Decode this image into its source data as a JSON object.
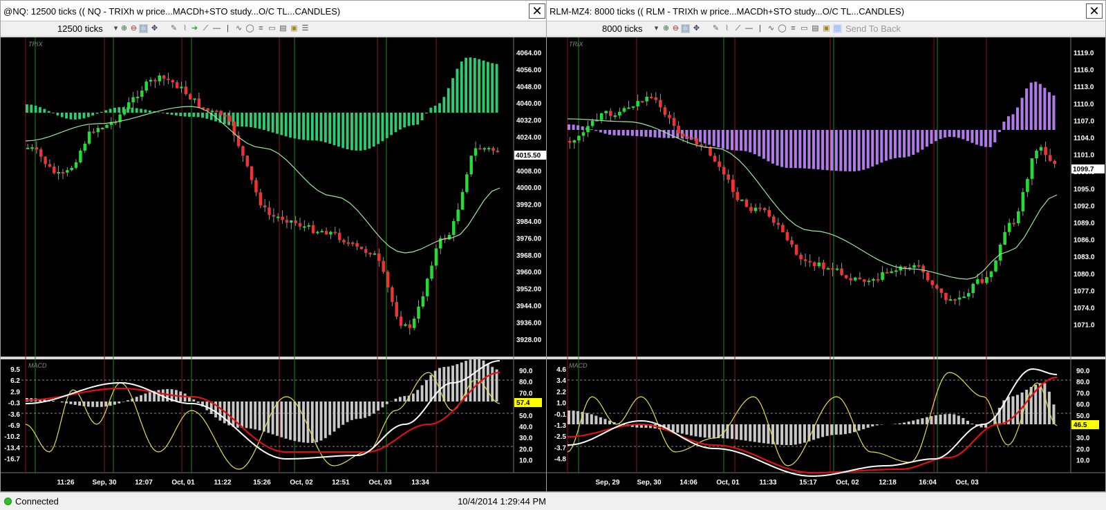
{
  "windows": [
    {
      "title": "@NQ: 12500 ticks (( NQ - TRIXh w price...MACDh+STO study...O/C TL...CANDLES)",
      "ticks_label": "12500 ticks",
      "send_to_back": "",
      "price_axis": [
        "4064.00",
        "4056.00",
        "4048.00",
        "4040.00",
        "4032.00",
        "4024.00",
        "4016.00",
        "4008.00",
        "4000.00",
        "3992.00",
        "3984.00",
        "3976.00",
        "3968.00",
        "3960.00",
        "3952.00",
        "3944.00",
        "3936.00",
        "3928.00"
      ],
      "last_price": "4015.50",
      "study_label": "TRIX",
      "macd_label": "MACD",
      "macd_axis": [
        "9.5",
        "6.2",
        "2.9",
        "-0.3",
        "-3.6",
        "-6.9",
        "-10.2",
        "-13.4",
        "-16.7"
      ],
      "sto_axis": [
        "90.0",
        "80.0",
        "70.0",
        "60.0",
        "50.0",
        "40.0",
        "30.0",
        "20.0",
        "10.0"
      ],
      "sto_last": "57.4",
      "time_axis": [
        "11:26",
        "Sep, 30",
        "12:07",
        "Oct, 01",
        "11:22",
        "15:26",
        "Oct, 02",
        "12:51",
        "Oct, 03",
        "13:34"
      ],
      "hist_color": "#2ecc71"
    },
    {
      "title": "RLM-MZ4: 8000 ticks (( RLM - TRIXh w price...MACDh+STO study...O/C TL...CANDLES)",
      "ticks_label": "8000 ticks",
      "send_to_back": "Send To Back",
      "price_axis": [
        "1119.0",
        "1116.0",
        "1113.0",
        "1110.0",
        "1107.0",
        "1104.0",
        "1101.0",
        "1098.0",
        "1095.0",
        "1092.0",
        "1089.0",
        "1086.0",
        "1083.0",
        "1080.0",
        "1077.0",
        "1074.0",
        "1071.0"
      ],
      "last_price": "1099.7",
      "study_label": "TRIX",
      "macd_label": "MACD",
      "macd_axis": [
        "4.6",
        "3.4",
        "2.2",
        "1.0",
        "-0.1",
        "-1.3",
        "-2.5",
        "-3.7",
        "-4.8"
      ],
      "sto_axis": [
        "90.0",
        "80.0",
        "70.0",
        "60.0",
        "50.0",
        "40.0",
        "30.0",
        "20.0",
        "10.0"
      ],
      "sto_last": "46.5",
      "time_axis": [
        "Sep, 29",
        "Sep, 30",
        "14:06",
        "Oct, 01",
        "11:33",
        "15:17",
        "Oct, 02",
        "12:18",
        "16:04",
        "Oct, 03"
      ],
      "hist_color": "#b07ae8"
    }
  ],
  "status": {
    "connection": "Connected",
    "datetime": "10/4/2014 1:29:44 PM"
  },
  "colors": {
    "up_candle": "#22dd33",
    "down_candle": "#ee3333",
    "ma_line": "#9be89b",
    "macd_white": "#ffffff",
    "macd_red": "#e01010",
    "sto_yellow": "#e8e040",
    "sto_tag": "#ffff00"
  }
}
